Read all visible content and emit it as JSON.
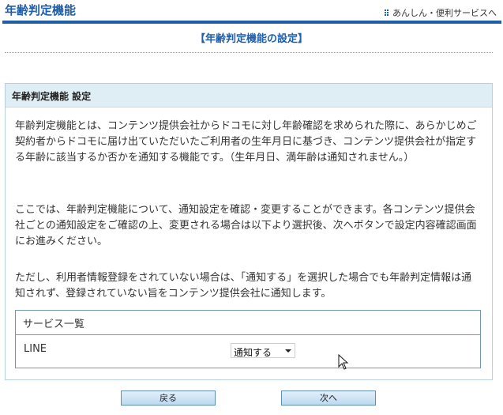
{
  "header": {
    "brand": "年齢判定機能",
    "top_link": "あんしん・便利サービスへ"
  },
  "page": {
    "title": "【年齢判定機能の設定】"
  },
  "panel": {
    "heading": "年齢判定機能 設定",
    "paragraph1": "年齢判定機能とは、コンテンツ提供会社からドコモに対し年齢確認を求められた際に、あらかじめご契約者からドコモに届け出ていただいたご利用者の生年月日に基づき、コンテンツ提供会社が指定する年齢に該当するか否かを通知する機能です。（生年月日、満年齢は通知されません。）",
    "paragraph2": "ここでは、年齢判定機能について、通知設定を確認・変更することができます。各コンテンツ提供会社ごとの通知設定をご確認の上、変更される場合は以下より選択後、次へボタンで設定内容確認画面にお進みください。",
    "paragraph3": "ただし、利用者情報登録をされていない場合は、「通知する」を選択した場合でも年齢判定情報は通知されず、登録されていない旨をコンテンツ提供会社に通知します。"
  },
  "service_list": {
    "heading": "サービス一覧",
    "items": [
      {
        "name": "LINE",
        "selected": "通知する"
      }
    ]
  },
  "buttons": {
    "back": "戻る",
    "next": "次へ"
  },
  "colors": {
    "brand_blue": "#1f5ea8",
    "panel_header": "#dfeef4",
    "border_blue": "#6f98b8"
  },
  "icons": {
    "top_link": "grid-dots-icon",
    "select": "chevron-down-icon",
    "pointer": "mouse-pointer-icon"
  }
}
